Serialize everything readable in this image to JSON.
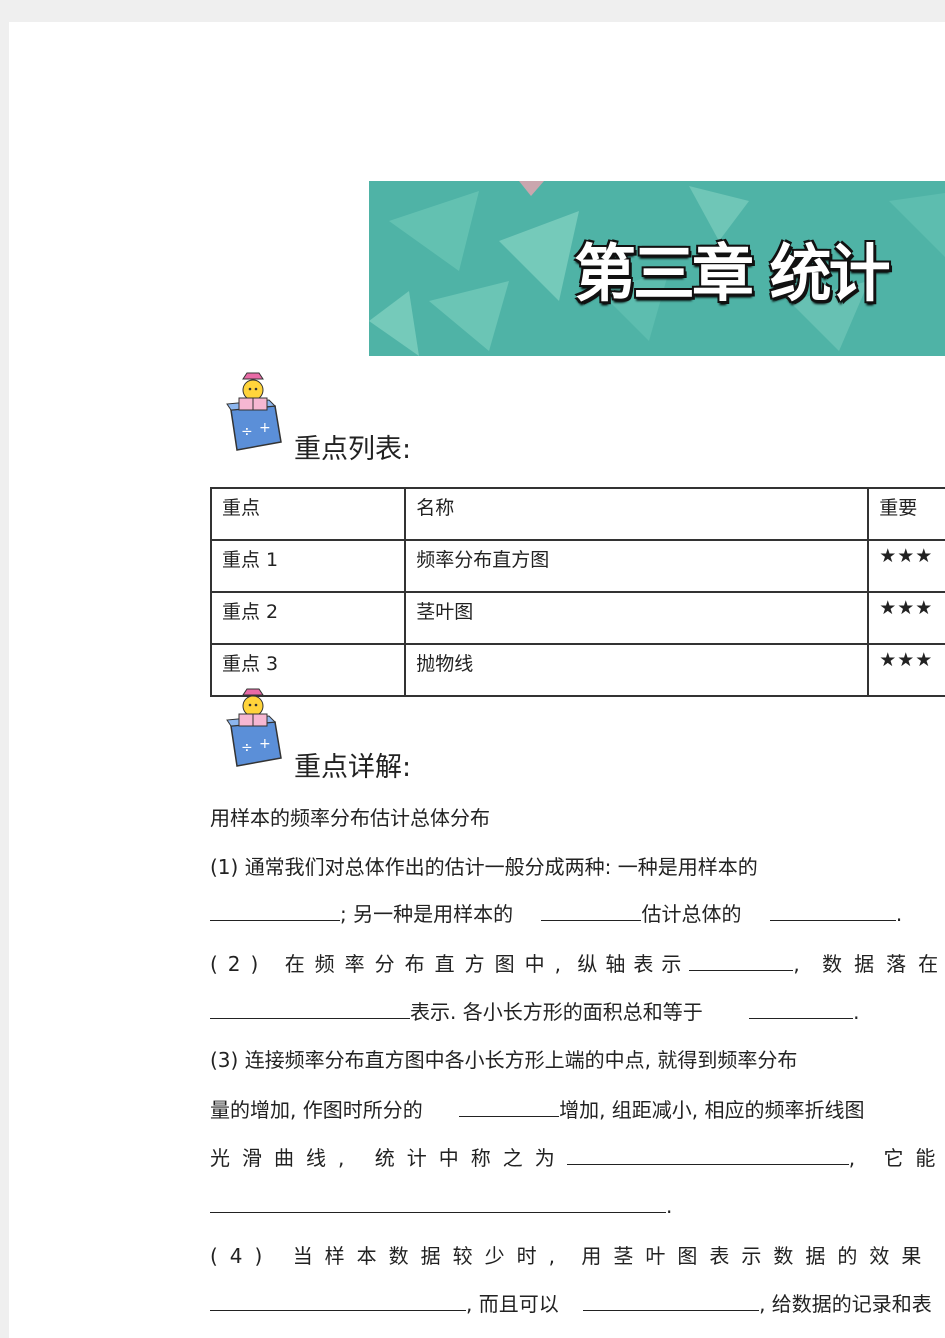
{
  "banner": {
    "title": "第三章 统计"
  },
  "key_points": {
    "heading": "重点列表:",
    "table": {
      "headers": [
        "重点",
        "名称",
        "重要"
      ],
      "rows": [
        {
          "id": "重点 1",
          "name": "频率分布直方图",
          "importance": "★★★"
        },
        {
          "id": "重点 2",
          "name": "茎叶图",
          "importance": "★★★"
        },
        {
          "id": "重点 3",
          "name": "抛物线",
          "importance": "★★★"
        }
      ]
    }
  },
  "details": {
    "heading": "重点详解:",
    "subtitle": "用样本的频率分布估计总体分布",
    "p1_line1": "(1) 通常我们对总体作出的估计一般分成两种: 一种是用样本的",
    "p1_line2_a": "; 另一种是用样本的",
    "p1_line2_b": "估计总体的",
    "p1_line2_c": ".",
    "p2_line1_a": "(2) 在频率分布直方图中,",
    "p2_line1_b": "纵轴表示",
    "p2_line1_c": ",",
    "p2_line1_d": "数据落在",
    "p2_line2_a": "表示. 各小长方形的面积总和等于",
    "p2_line2_b": ".",
    "p3_line1": "(3) 连接频率分布直方图中各小长方形上端的中点, 就得到频率分布",
    "p3_line2_a": "量的增加, 作图时所分的",
    "p3_line2_b": "增加, 组距减小, 相应的频率折线图",
    "p3_line3_a": "光滑曲线,",
    "p3_line3_b": "统计中称之为",
    "p3_line3_c": ",",
    "p3_line3_d": "它能够",
    "p3_line4": ".",
    "p4_line1_a": "(4) 当样本数据较少时,",
    "p4_line1_b": "用茎叶图表示数据的效果",
    "p4_line2_a": ", 而且可以",
    "p4_line2_b": ", 给数据的记录和表"
  },
  "colors": {
    "banner_bg": "#4fb3a6",
    "banner_shapes": "#7fd0bf",
    "page_bg": "#ffffff"
  }
}
